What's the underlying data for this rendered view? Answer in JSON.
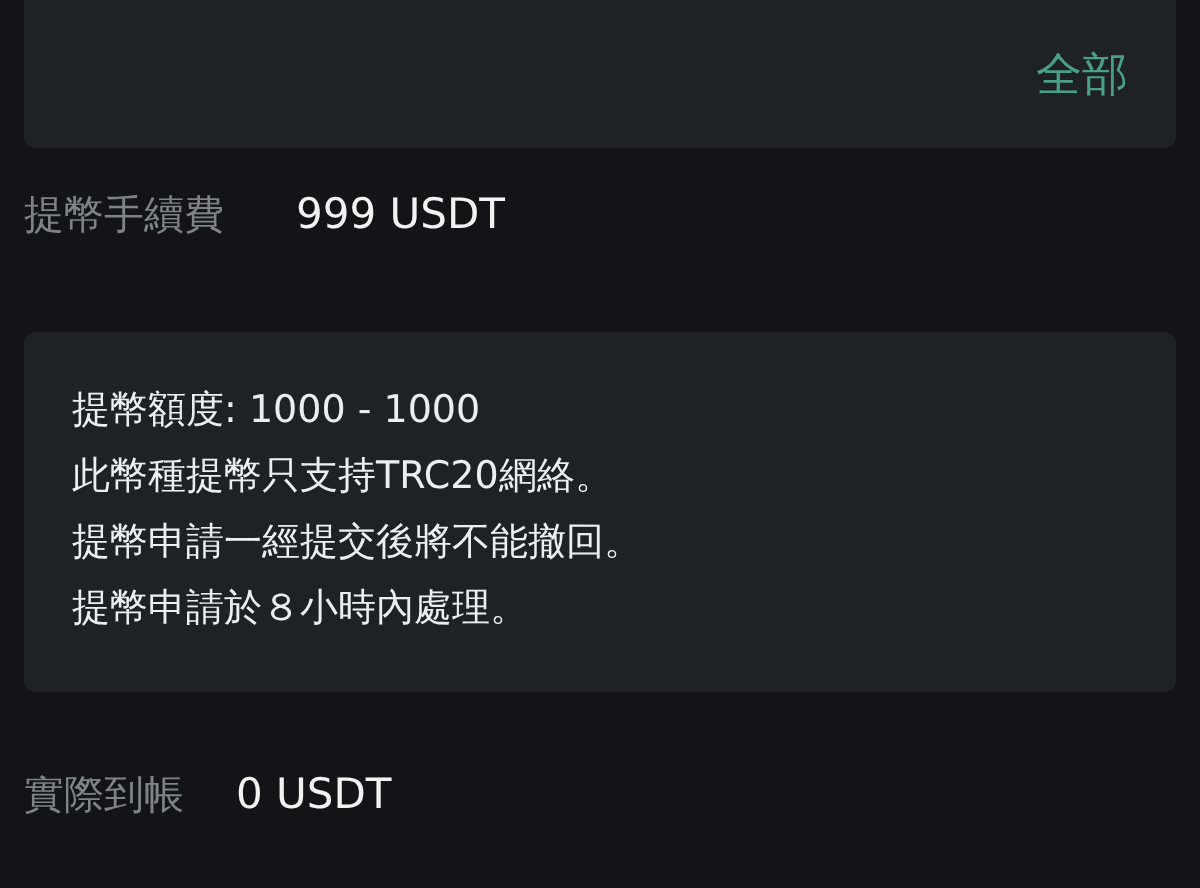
{
  "amount_card": {
    "all_button": "全部"
  },
  "fee": {
    "label": "提幣手續費",
    "value": "999 USDT"
  },
  "notice": {
    "lines": [
      "提幣額度: 1000 - 1000",
      "此幣種提幣只支持TRC20網絡。",
      "提幣申請一經提交後將不能撤回。",
      "提幣申請於８小時內處理。"
    ]
  },
  "received": {
    "label": "實際到帳",
    "value": "0 USDT"
  }
}
